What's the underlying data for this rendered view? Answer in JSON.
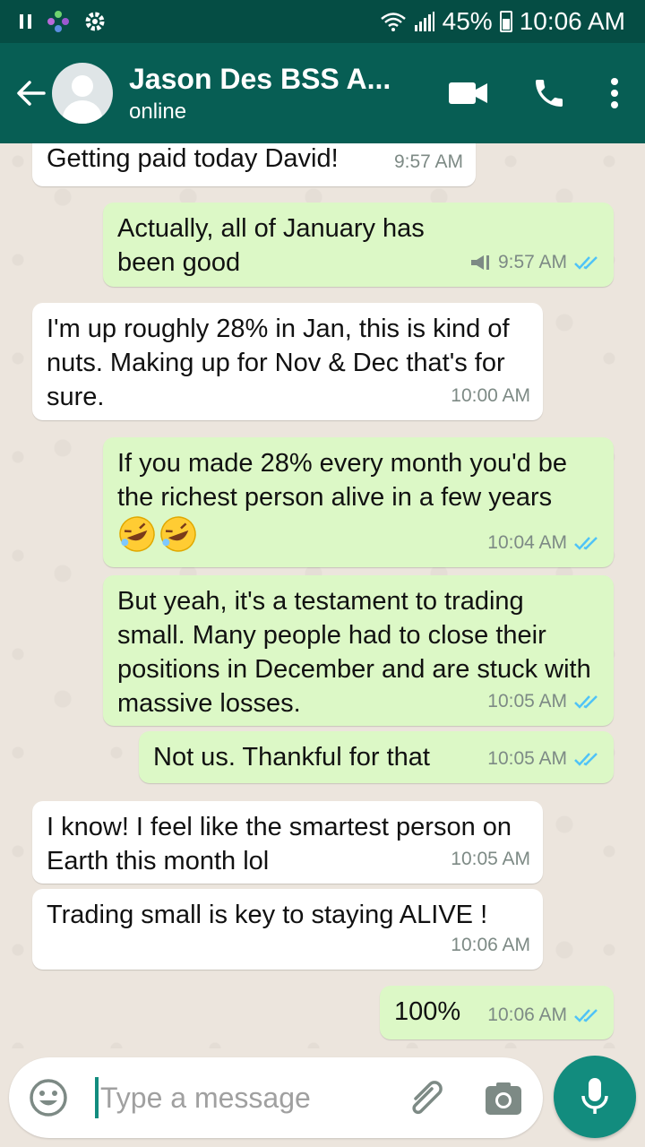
{
  "status_bar": {
    "battery": "45%",
    "time": "10:06 AM"
  },
  "header": {
    "contact_name": "Jason Des BSS A...",
    "contact_status": "online"
  },
  "messages": [
    {
      "direction": "in",
      "text": "Getting paid today David!",
      "time": "9:57 AM"
    },
    {
      "direction": "out",
      "text": "Actually, all of January has been good",
      "time": "9:57 AM",
      "status": "read"
    },
    {
      "direction": "in",
      "text": "I'm up roughly 28% in Jan, this is kind of nuts. Making up for Nov & Dec that's for sure.",
      "time": "10:00 AM"
    },
    {
      "direction": "out",
      "text": "If you made 28% every month you'd be the richest person alive in a few years",
      "emoji": "rolling-on-floor-laughing x2",
      "time": "10:04 AM",
      "status": "read"
    },
    {
      "direction": "out",
      "text": "But yeah, it's a testament to trading small. Many people had to close their positions in December and are stuck with massive losses.",
      "time": "10:05 AM",
      "status": "read"
    },
    {
      "direction": "out",
      "text": "Not us. Thankful for that",
      "time": "10:05 AM",
      "status": "read"
    },
    {
      "direction": "in",
      "text": "I know! I feel like the smartest person on Earth this month lol",
      "time": "10:05 AM"
    },
    {
      "direction": "in",
      "text": "Trading small is key to staying ALIVE !",
      "time": "10:06 AM"
    },
    {
      "direction": "out",
      "text": "100%",
      "time": "10:06 AM",
      "status": "read"
    }
  ],
  "input": {
    "placeholder": "Type a message"
  },
  "colors": {
    "status_bar": "#054d44",
    "header": "#075e54",
    "outgoing_bubble": "#dcf8c6",
    "incoming_bubble": "#ffffff",
    "read_tick": "#4fc3f7",
    "mic_button": "#128c7e"
  },
  "icons": [
    "back-arrow-icon",
    "video-call-icon",
    "phone-icon",
    "more-vert-icon",
    "emoji-icon",
    "attach-icon",
    "camera-icon",
    "mic-icon",
    "double-check-icon",
    "broadcast-icon"
  ]
}
